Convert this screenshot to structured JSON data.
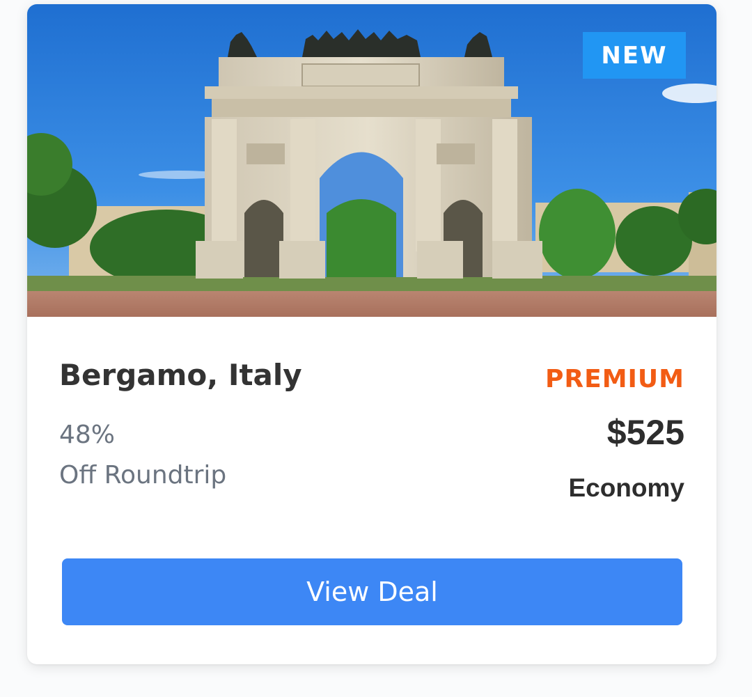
{
  "card": {
    "badge": "NEW",
    "destination": "Bergamo, Italy",
    "discount_percent": "48%",
    "discount_label": "Off Roundtrip",
    "tier": "PREMIUM",
    "price": "$525",
    "cabin_class": "Economy",
    "cta_label": "View Deal",
    "image_subject": "triumphal-arch-photo"
  },
  "colors": {
    "badge_bg": "#2196f3",
    "tier_text": "#f25c14",
    "button_bg": "#3d87f5",
    "title_text": "#333333",
    "muted_text": "#6b7480"
  }
}
